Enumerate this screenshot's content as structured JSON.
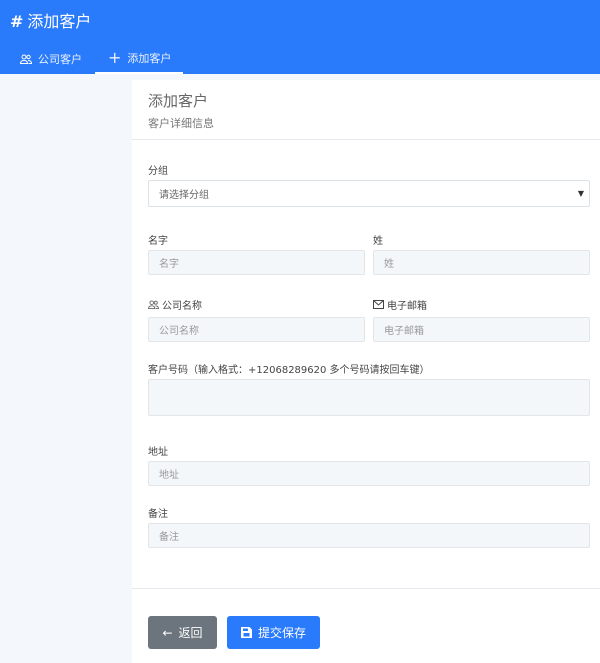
{
  "header": {
    "title": "添加客户",
    "tabs": [
      {
        "label": "公司客户"
      },
      {
        "label": "添加客户"
      }
    ]
  },
  "card": {
    "title": "添加客户",
    "subtitle": "客户详细信息"
  },
  "form": {
    "group": {
      "label": "分组",
      "placeholder": "请选择分组"
    },
    "first_name": {
      "label": "名字",
      "placeholder": "名字"
    },
    "last_name": {
      "label": "姓",
      "placeholder": "姓"
    },
    "company": {
      "label": "公司名称",
      "placeholder": "公司名称"
    },
    "email": {
      "label": "电子邮箱",
      "placeholder": "电子邮箱"
    },
    "phone": {
      "label": "客户号码（输入格式：+12068289620 多个号码请按回车键）"
    },
    "address": {
      "label": "地址",
      "placeholder": "地址"
    },
    "note": {
      "label": "备注",
      "placeholder": "备注"
    }
  },
  "buttons": {
    "back": "返回",
    "submit": "提交保存"
  },
  "colors": {
    "primary": "#2a7afc",
    "secondary": "#6c757d"
  }
}
